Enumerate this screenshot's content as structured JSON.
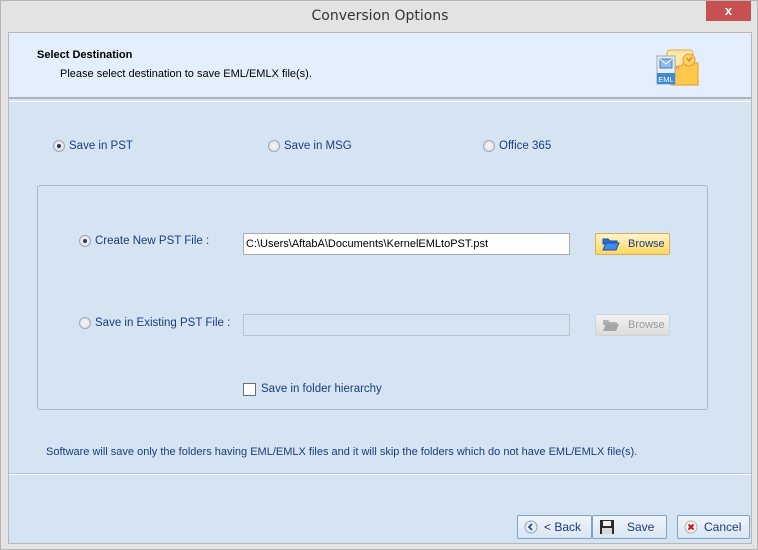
{
  "window": {
    "title": "Conversion Options",
    "close_label": "x"
  },
  "header": {
    "title": "Select Destination",
    "subtitle": "Please select destination to save EML/EMLX file(s).",
    "icon": "eml-to-folder-icon",
    "icon_badge": "EML"
  },
  "destination_options": [
    {
      "label": "Save in PST",
      "checked": true
    },
    {
      "label": "Save in MSG",
      "checked": false
    },
    {
      "label": "Office 365",
      "checked": false
    }
  ],
  "pst_options": {
    "create_new": {
      "label": "Create New PST File :",
      "checked": true,
      "path_value": "C:\\Users\\AftabA\\Documents\\KernelEMLtoPST.pst",
      "browse_label": "Browse",
      "browse_enabled": true
    },
    "existing": {
      "label": "Save in Existing PST File :",
      "checked": false,
      "path_value": "",
      "browse_label": "Browse",
      "browse_enabled": false
    },
    "folder_hierarchy": {
      "label": "Save in folder hierarchy",
      "checked": false
    }
  },
  "note": "Software will save only the folders having EML/EMLX files and it will skip the folders which do not have EML/EMLX file(s).",
  "footer": {
    "back_label": "< Back",
    "save_label": "Save",
    "cancel_label": "Cancel"
  }
}
